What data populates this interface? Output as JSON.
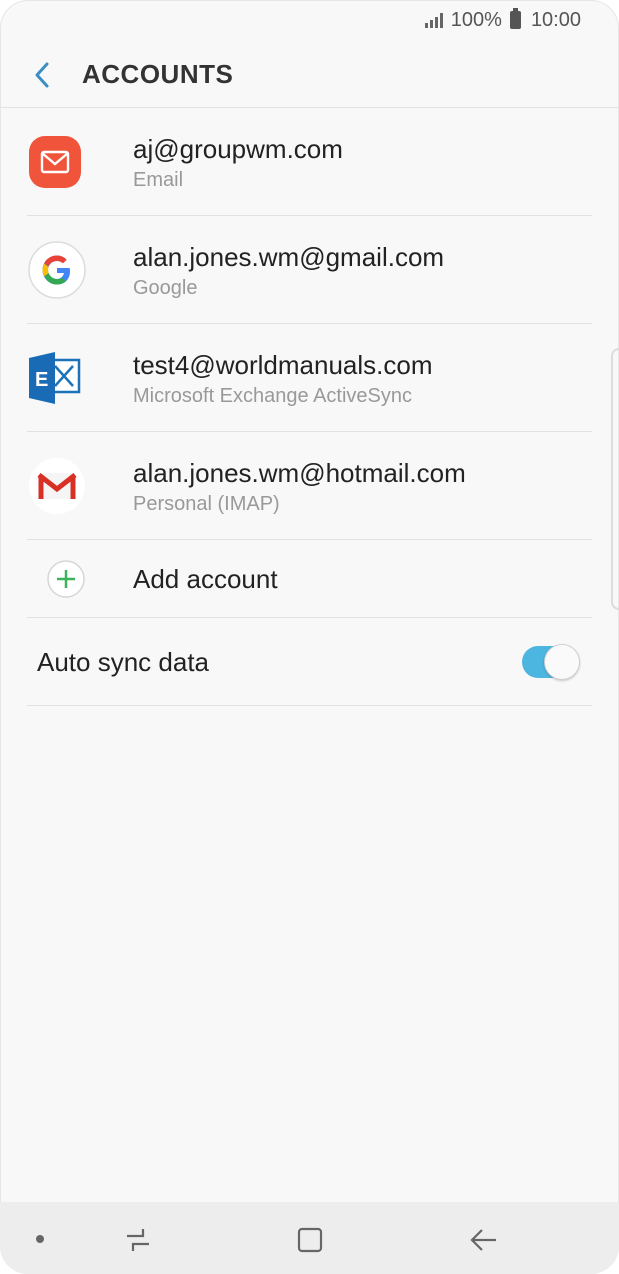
{
  "status_bar": {
    "battery_percent": "100%",
    "time": "10:00"
  },
  "header": {
    "title": "ACCOUNTS"
  },
  "accounts": [
    {
      "email": "aj@groupwm.com",
      "type": "Email",
      "icon": "email-app-icon"
    },
    {
      "email": "alan.jones.wm@gmail.com",
      "type": "Google",
      "icon": "google-icon"
    },
    {
      "email": "test4@worldmanuals.com",
      "type": "Microsoft Exchange ActiveSync",
      "icon": "exchange-icon"
    },
    {
      "email": "alan.jones.wm@hotmail.com",
      "type": "Personal (IMAP)",
      "icon": "gmail-icon"
    }
  ],
  "add_account": {
    "label": "Add account",
    "icon": "plus-circle-icon"
  },
  "auto_sync": {
    "label": "Auto sync data",
    "enabled": true
  },
  "colors": {
    "accent": "#4cb5e0",
    "email_red": "#f0543b",
    "add_green": "#3cb35a"
  },
  "nav_bar": {
    "icons": [
      "menu-dot-icon",
      "recent-apps-icon",
      "home-icon",
      "back-arrow-icon"
    ]
  }
}
